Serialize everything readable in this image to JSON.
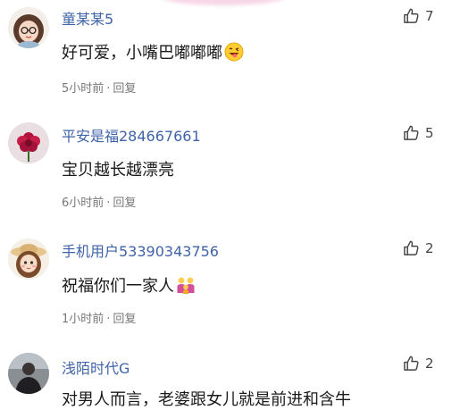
{
  "comments": [
    {
      "username": "童某某5",
      "text": "好可爱，小嘴巴嘟嘟嘟",
      "emoji_icon": "grinning-tongue-emoji",
      "time": "5小时前",
      "separator": "·",
      "reply": "回复",
      "likes": "7",
      "avatar_icon": "cartoon-girl-glasses-avatar"
    },
    {
      "username": "平安是福284667661",
      "text": "宝贝越长越漂亮",
      "time": "6小时前",
      "separator": "·",
      "reply": "回复",
      "likes": "5",
      "avatar_icon": "red-flower-avatar"
    },
    {
      "username": "手机用户53390343756",
      "text": "祝福你们一家人",
      "emoji_icon": "family-emoji",
      "time": "1小时前",
      "separator": "·",
      "reply": "回复",
      "likes": "2",
      "avatar_icon": "cartoon-girl-hat-avatar"
    },
    {
      "username": "浅陌时代G",
      "text": "对男人而言，老婆跟女儿就是前进和含牛",
      "likes": "2",
      "avatar_icon": "dark-photo-avatar"
    }
  ],
  "colors": {
    "username": "#3f63a8",
    "text": "#1a1a1a",
    "meta": "#777777"
  },
  "icons": {
    "like": "thumbs-up-icon"
  }
}
